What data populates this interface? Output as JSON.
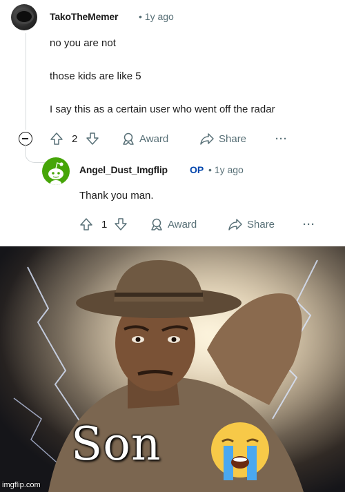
{
  "comment": {
    "username": "TakoTheMemer",
    "meta": "• 1y ago",
    "lines": [
      "no you are not",
      "those kids are like 5",
      "I say this as a certain user who went off the radar"
    ],
    "votes": "2",
    "award_label": "Award",
    "share_label": "Share",
    "more_label": "···"
  },
  "reply": {
    "username": "Angel_Dust_Imgflip",
    "op_badge": "OP",
    "meta": "• 1y ago",
    "text": "Thank you man.",
    "votes": "1",
    "award_label": "Award",
    "share_label": "Share",
    "more_label": "···"
  },
  "meme": {
    "caption": "Son",
    "emoji": "loudly-crying-face",
    "watermark": "imgflip.com"
  },
  "colors": {
    "text": "#1c1c1c",
    "meta": "#576f76",
    "op_blue": "#0045ac",
    "avatar_green": "#46a508",
    "thread_line": "#d6dadc"
  }
}
